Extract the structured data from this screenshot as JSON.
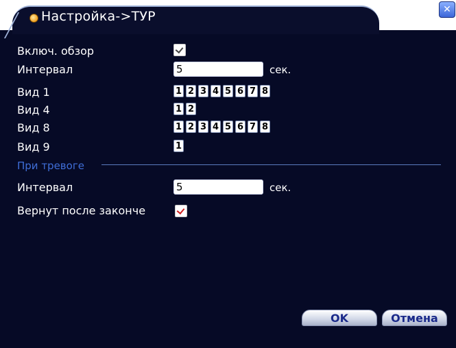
{
  "title": "Настройка->ТУР",
  "rows": {
    "enable_tour": "Включ. обзор",
    "interval": {
      "label": "Интервал",
      "value": "5",
      "unit": "сек."
    },
    "view1": {
      "label": "Вид 1",
      "cells": [
        "1",
        "2",
        "3",
        "4",
        "5",
        "6",
        "7",
        "8"
      ]
    },
    "view4": {
      "label": "Вид 4",
      "cells": [
        "1",
        "2"
      ]
    },
    "view8": {
      "label": "Вид 8",
      "cells": [
        "1",
        "2",
        "3",
        "4",
        "5",
        "6",
        "7",
        "8"
      ]
    },
    "view9": {
      "label": "Вид 9",
      "cells": [
        "1"
      ]
    }
  },
  "alarm": {
    "section_title": "При тревоге",
    "interval": {
      "label": "Интервал",
      "value": "5",
      "unit": "сек."
    },
    "return_label": "Вернут после законче"
  },
  "buttons": {
    "ok": "OK",
    "cancel": "Отмена"
  },
  "colors": {
    "background": "#060a26",
    "accent": "#3f6ed8"
  }
}
